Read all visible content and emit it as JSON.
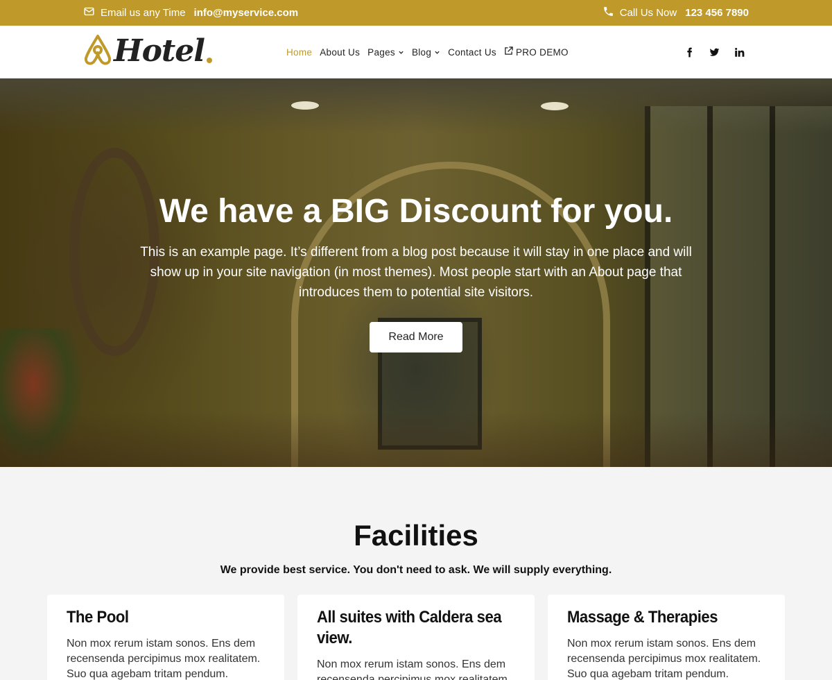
{
  "topbar": {
    "email_label": "Email us any Time",
    "email": "info@myservice.com",
    "phone_label": "Call Us Now",
    "phone": "123 456 7890",
    "background": "#bf9a2b"
  },
  "header": {
    "logo_text": "Hotel",
    "nav": [
      {
        "label": "Home",
        "active": true
      },
      {
        "label": "About Us"
      },
      {
        "label": "Pages",
        "dropdown": true
      },
      {
        "label": "Blog",
        "dropdown": true
      },
      {
        "label": "Contact Us"
      },
      {
        "label": "PRO DEMO",
        "icon": "external-link-icon"
      }
    ],
    "social": [
      "facebook-icon",
      "twitter-icon",
      "linkedin-icon"
    ],
    "accent": "#bf9a2b"
  },
  "hero": {
    "title": "We have a BIG Discount for you.",
    "description": "This is an example page. It’s different from a blog post because it will stay in one place and will show up in your site navigation (in most themes). Most people start with an About page that introduces them to potential site visitors.",
    "button_label": "Read More"
  },
  "facilities": {
    "title": "Facilities",
    "subtitle": "We provide best service. You don't need to ask. We will supply everything.",
    "cards": [
      {
        "title": "The Pool",
        "text": "Non mox rerum istam sonos. Ens dem recensenda percipimus mox realitatem. Suo qua agebam tritam pendum."
      },
      {
        "title": "All suites with Caldera sea view.",
        "text": "Non mox rerum istam sonos. Ens dem recensenda percipimus mox realitatem."
      },
      {
        "title": "Massage & Therapies",
        "text": "Non mox rerum istam sonos. Ens dem recensenda percipimus mox realitatem. Suo qua agebam tritam pendum."
      }
    ]
  }
}
